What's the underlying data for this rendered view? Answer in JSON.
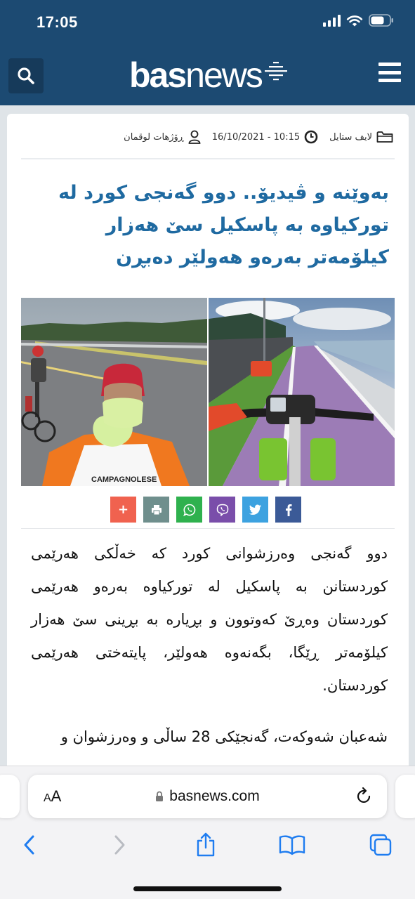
{
  "status_bar": {
    "time": "17:05"
  },
  "header": {
    "logo_bold": "bas",
    "logo_light": "news"
  },
  "article": {
    "category": "لایف ستایل",
    "datetime": "16/10/2021 - 10:15",
    "author": "ڕۆژهات لوقمان",
    "headline": "بەوێنە و ڤیدیۆ.. دوو گەنجی کورد لە تورکیاوە بە پاسکیل سێ هەزار کیلۆمەتر بەرەو هەولێر دەبڕن",
    "paragraphs": [
      "دوو گەنجی وەرزشوانی کورد کە خەڵکی هەرێمی کوردستانن بە پاسکیل لە تورکیاوە بەرەو هەرێمی کوردستان وەڕێ کەوتوون و بڕیارە بە بڕینی سێ هەزار کیلۆمەتر ڕێگا، بگەنەوە هەولێر، پایتەختی هەرێمی کوردستان.",
      "شەعبان شەوکەت، گەنجێکی 28 ساڵی و وەرزشوان و"
    ],
    "photo_jersey_text": "CAMPAGNOLESE"
  },
  "share": {
    "more": "+",
    "colors": {
      "more": "#f0624f",
      "print": "#6f8f8d",
      "whatsapp": "#2fb14e",
      "viber": "#7a4eaa",
      "twitter": "#3da2e0",
      "facebook": "#3b5a97"
    }
  },
  "browser": {
    "aa_label_small": "A",
    "aa_label_large": "A",
    "url": "basnews.com"
  }
}
